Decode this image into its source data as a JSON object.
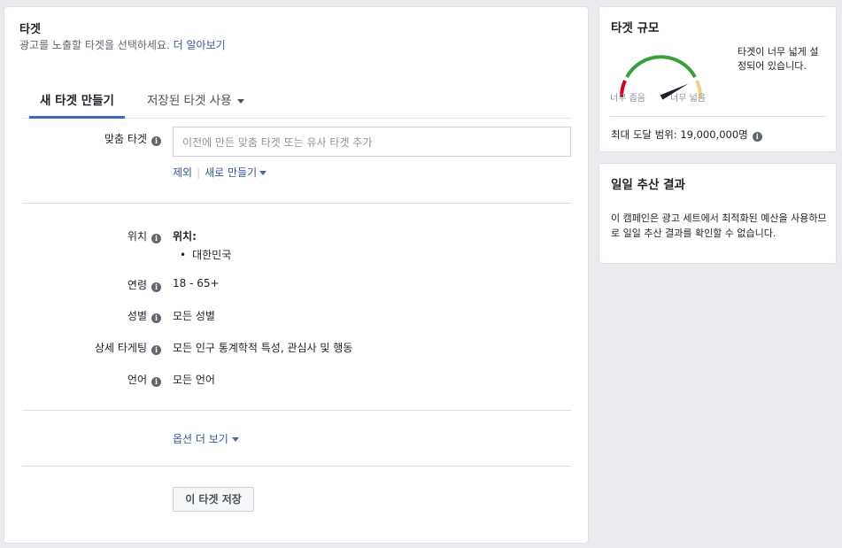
{
  "audience": {
    "title": "타겟",
    "subtitle": "광고를 노출할 타겟을 선택하세요.",
    "learn_more": "더 알아보기",
    "tabs": {
      "new": "새 타겟 만들기",
      "saved": "저장된 타겟 사용"
    },
    "custom": {
      "label": "맞춤 타겟",
      "placeholder": "이전에 만든 맞춤 타겟 또는 유사 타겟 추가",
      "exclude": "제외",
      "create_new": "새로 만들기"
    },
    "location": {
      "label": "위치",
      "heading": "위치:",
      "items": [
        "대한민국"
      ]
    },
    "age": {
      "label": "연령",
      "value": "18 - 65+"
    },
    "gender": {
      "label": "성별",
      "value": "모든 성별"
    },
    "detailed": {
      "label": "상세 타게팅",
      "value": "모든 인구 통계학적 특성, 관심사 및 행동"
    },
    "language": {
      "label": "언어",
      "value": "모든 언어"
    },
    "more_options": "옵션 더 보기",
    "save_button": "이 타겟 저장",
    "info_glyph": "i"
  },
  "audience_size": {
    "title": "타겟 규모",
    "gauge_left": "너무 좁음",
    "gauge_right": "너무 넓음",
    "message": "타겟이 너무 넓게 설정되어 있습니다.",
    "reach": "최대 도달 범위: 19,000,000명",
    "gauge_colors": {
      "low": "#d0021b",
      "mid": "#3a9f3a",
      "high": "#f0d18a",
      "needle": "#1d2129"
    },
    "gauge_level": 0.85
  },
  "daily_results": {
    "title": "일일 추산 결과",
    "message": "이 캠페인은 광고 세트에서 최적화된 예산을 사용하므로 일일 추산 결과를 확인할 수 없습니다."
  }
}
